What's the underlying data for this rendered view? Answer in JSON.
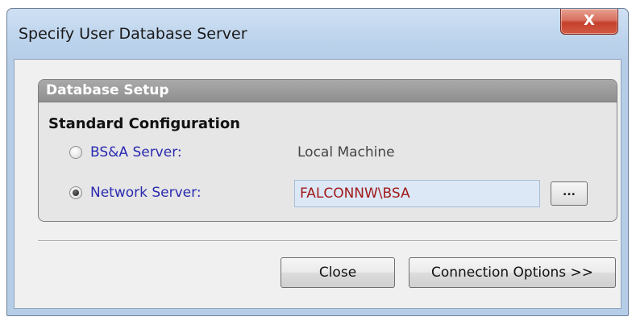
{
  "window": {
    "title": "Specify User Database Server",
    "close_glyph": "X"
  },
  "group": {
    "header": "Database Setup",
    "section_title": "Standard Configuration",
    "options": [
      {
        "label": "BS&A Server:",
        "selected": false,
        "value": "Local Machine"
      },
      {
        "label": "Network Server:",
        "selected": true,
        "value": "FALCONNW\\BSA"
      }
    ],
    "browse_label": "..."
  },
  "buttons": {
    "close_label": "Close",
    "options_label": "Connection Options >>"
  },
  "colors": {
    "radio_label": "#2a2ab0",
    "input_text": "#a11a1a",
    "input_bg": "#dce8f5",
    "group_header": "#9a9a9a"
  }
}
